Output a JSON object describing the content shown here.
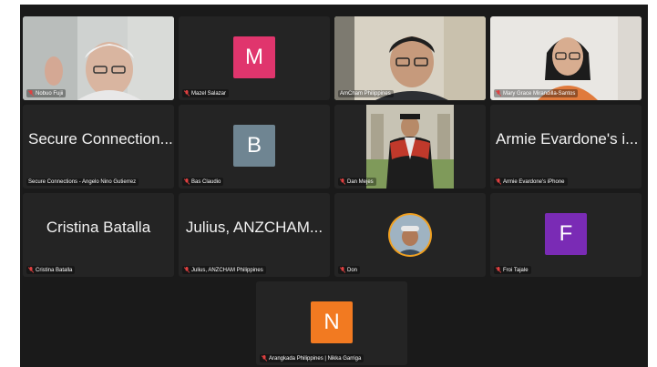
{
  "colors": {
    "stage_bg": "#1a1a1a",
    "tile_bg": "#242424",
    "active_speaker_border": "#7fd36b",
    "muted_icon": "#e04040",
    "avatar_m": "#e0356d",
    "avatar_b": "#6f8592",
    "avatar_f": "#7a2bb5",
    "avatar_n": "#f27a21"
  },
  "participants": [
    {
      "name": "Nobuo Fujii",
      "muted": true,
      "video": true
    },
    {
      "name": "Mazel Salazar",
      "muted": true,
      "avatar_letter": "M"
    },
    {
      "name": "AmCham Philippines",
      "muted": false,
      "video": true,
      "active_speaker": true
    },
    {
      "name": "Mary Grace Mirandilla-Santos",
      "muted": true,
      "video": true
    },
    {
      "name": "Secure Connections - Angelo Nino Gutierrez",
      "muted": false,
      "display_name": "Secure Connection..."
    },
    {
      "name": "Bas Claudio",
      "muted": true,
      "avatar_letter": "B"
    },
    {
      "name": "Dan Mejes",
      "muted": true,
      "video": true
    },
    {
      "name": "Armie Evardone's iPhone",
      "muted": true,
      "display_name": "Armie Evardone's i..."
    },
    {
      "name": "Cristina Batalla",
      "muted": true,
      "display_name": "Cristina Batalla"
    },
    {
      "name": "Julius, ANZCHAM Philippines",
      "muted": true,
      "display_name": "Julius, ANZCHAM..."
    },
    {
      "name": "Don",
      "muted": true,
      "profile_photo": true
    },
    {
      "name": "Froi Tajale",
      "muted": true,
      "avatar_letter": "F"
    },
    {
      "name": "Arangkada Philippines | Nikka Garriga",
      "muted": true,
      "avatar_letter": "N"
    }
  ]
}
